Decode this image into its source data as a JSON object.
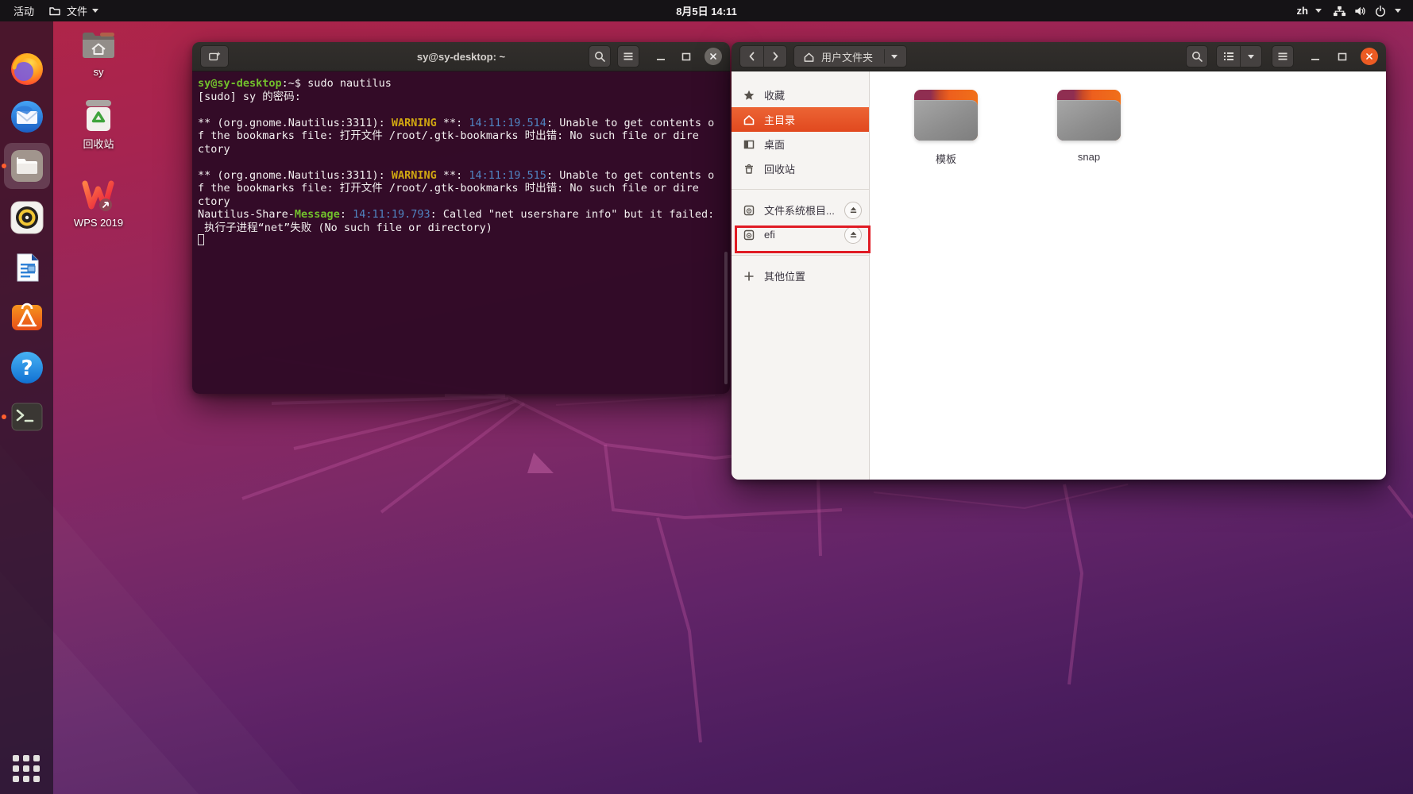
{
  "top_bar": {
    "activities": "活动",
    "app_menu": {
      "label": "文件"
    },
    "clock": "8月5日 14:11",
    "input_method": "zh"
  },
  "dock": {
    "items": [
      {
        "name": "firefox",
        "running": false,
        "active": false
      },
      {
        "name": "thunderbird",
        "running": false,
        "active": false
      },
      {
        "name": "files",
        "running": true,
        "active": true
      },
      {
        "name": "rhythmbox",
        "running": false,
        "active": false
      },
      {
        "name": "libreoffice-writer",
        "running": false,
        "active": false
      },
      {
        "name": "ubuntu-software",
        "running": false,
        "active": false
      },
      {
        "name": "help",
        "running": false,
        "active": false
      },
      {
        "name": "terminal",
        "running": true,
        "active": false
      }
    ]
  },
  "desktop": {
    "icons": [
      {
        "icon": "home-folder",
        "label": "sy"
      },
      {
        "icon": "trash",
        "label": "回收站"
      },
      {
        "icon": "wps",
        "label": "WPS 2019"
      }
    ]
  },
  "terminal_window": {
    "title": "sy@sy-desktop: ~",
    "lines": [
      {
        "segments": [
          {
            "t": "sy@sy-desktop",
            "c": "green"
          },
          {
            "t": ":~$ sudo nautilus",
            "c": "fg"
          }
        ]
      },
      {
        "segments": [
          {
            "t": "[sudo] sy 的密码:",
            "c": "fg"
          }
        ]
      },
      {
        "segments": []
      },
      {
        "segments": [
          {
            "t": "** (org.gnome.Nautilus:3311): ",
            "c": "fg"
          },
          {
            "t": "WARNING",
            "c": "yellow"
          },
          {
            "t": " **: ",
            "c": "fg"
          },
          {
            "t": "14:11:19.514",
            "c": "blue"
          },
          {
            "t": ": Unable to get contents o",
            "c": "fg"
          }
        ]
      },
      {
        "segments": [
          {
            "t": "f the bookmarks file: 打开文件 /root/.gtk-bookmarks 时出错: No such file or dire",
            "c": "fg"
          }
        ]
      },
      {
        "segments": [
          {
            "t": "ctory",
            "c": "fg"
          }
        ]
      },
      {
        "segments": []
      },
      {
        "segments": [
          {
            "t": "** (org.gnome.Nautilus:3311): ",
            "c": "fg"
          },
          {
            "t": "WARNING",
            "c": "yellow"
          },
          {
            "t": " **: ",
            "c": "fg"
          },
          {
            "t": "14:11:19.515",
            "c": "blue"
          },
          {
            "t": ": Unable to get contents o",
            "c": "fg"
          }
        ]
      },
      {
        "segments": [
          {
            "t": "f the bookmarks file: 打开文件 /root/.gtk-bookmarks 时出错: No such file or dire",
            "c": "fg"
          }
        ]
      },
      {
        "segments": [
          {
            "t": "ctory",
            "c": "fg"
          }
        ]
      },
      {
        "segments": [
          {
            "t": "Nautilus-Share-",
            "c": "fg"
          },
          {
            "t": "Message",
            "c": "green"
          },
          {
            "t": ": ",
            "c": "fg"
          },
          {
            "t": "14:11:19.793",
            "c": "blue"
          },
          {
            "t": ": Called \"net usershare info\" but it failed: ",
            "c": "fg"
          }
        ]
      },
      {
        "segments": [
          {
            "t": " 执行子进程“net”失败 (No such file or directory)",
            "c": "fg"
          }
        ]
      },
      {
        "segments": [
          {
            "t": "",
            "c": "cursor"
          }
        ]
      }
    ]
  },
  "files_window": {
    "path_button": {
      "label": "用户文件夹"
    },
    "sidebar": {
      "items": [
        {
          "icon": "star",
          "label": "收藏",
          "selected": false,
          "eject": false,
          "annotated": false,
          "sep_after": false
        },
        {
          "icon": "home",
          "label": "主目录",
          "selected": true,
          "eject": false,
          "annotated": false,
          "sep_after": false
        },
        {
          "icon": "desktop",
          "label": "桌面",
          "selected": false,
          "eject": false,
          "annotated": false,
          "sep_after": false
        },
        {
          "icon": "trash",
          "label": "回收站",
          "selected": false,
          "eject": false,
          "annotated": false,
          "sep_after": true
        },
        {
          "icon": "disk",
          "label": "文件系统根目...",
          "selected": false,
          "eject": true,
          "annotated": true,
          "sep_after": false
        },
        {
          "icon": "disk",
          "label": "efi",
          "selected": false,
          "eject": true,
          "annotated": false,
          "sep_after": true
        },
        {
          "icon": "plus",
          "label": "其他位置",
          "selected": false,
          "eject": false,
          "annotated": false,
          "sep_after": false
        }
      ]
    },
    "folders": [
      {
        "label": "模板"
      },
      {
        "label": "snap"
      }
    ]
  },
  "colors": {
    "accent_orange": "#e95420",
    "annotation_red": "#e01b24",
    "selected_sidebar": "#e8512a",
    "terminal_background": "#2f0a26",
    "prompt_green": "#72c02c",
    "warning_yellow": "#d0a711",
    "timestamp_blue": "#5084c1"
  }
}
